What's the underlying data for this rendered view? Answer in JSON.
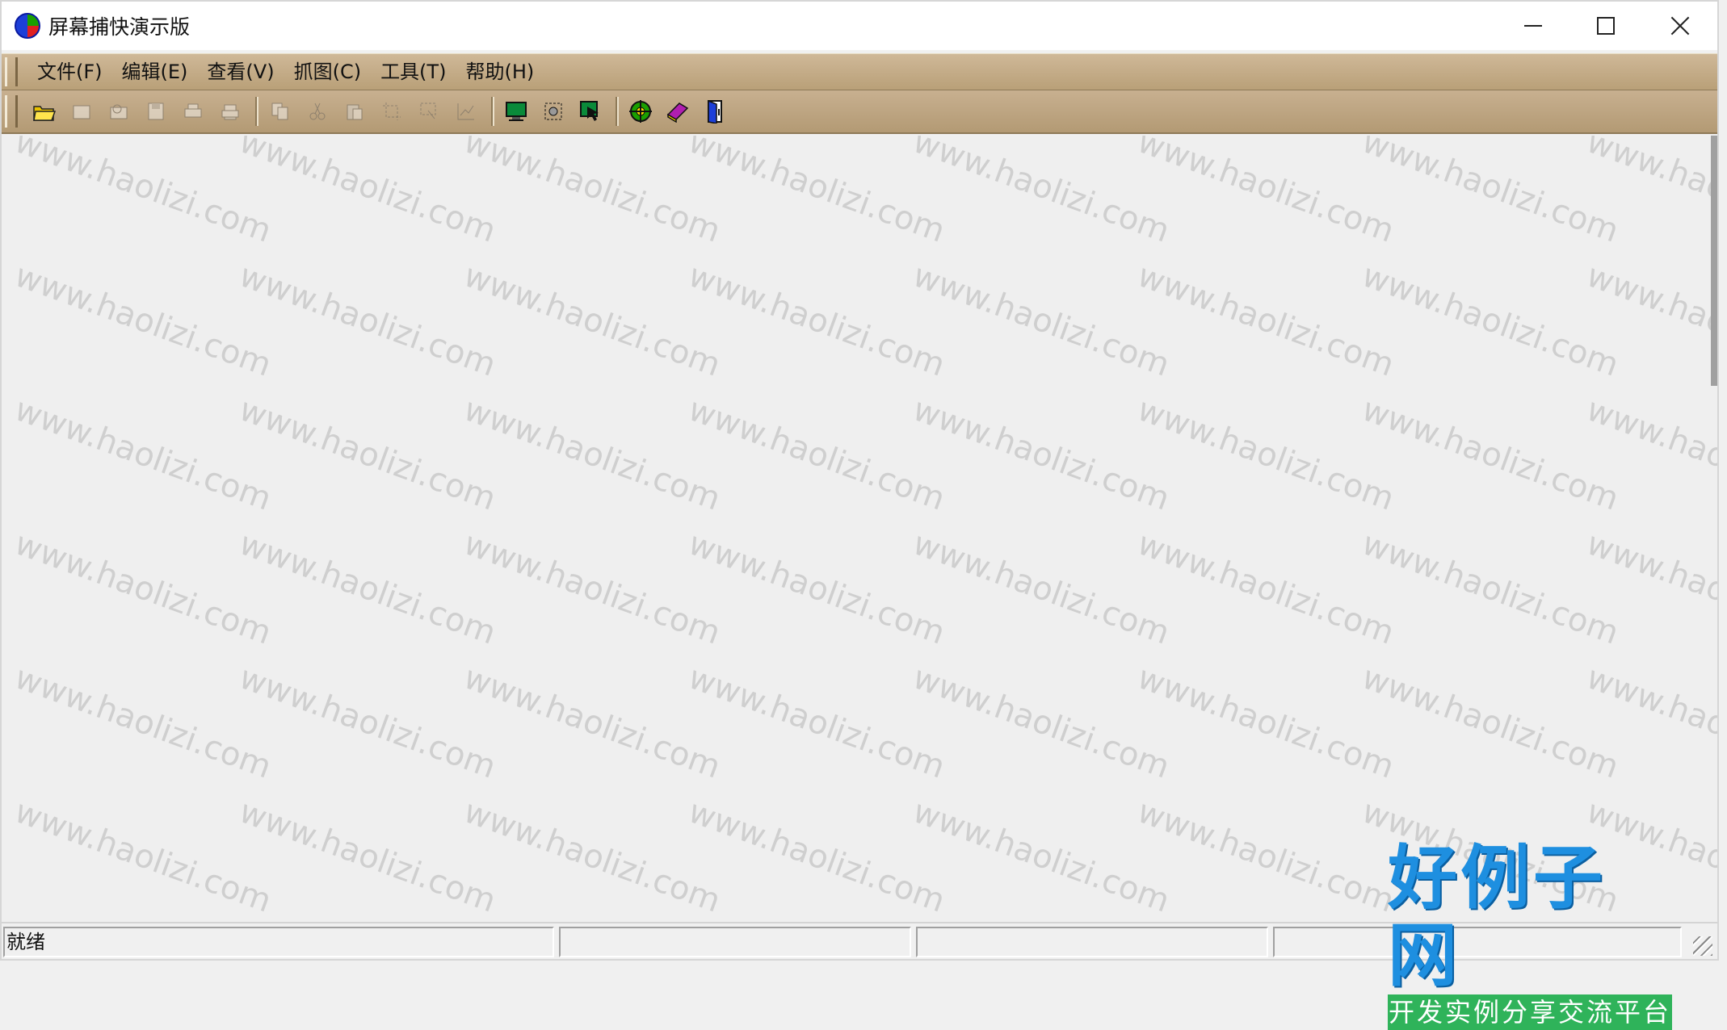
{
  "window": {
    "title": "屏幕捕快演示版"
  },
  "menu": [
    "文件(F)",
    "编辑(E)",
    "查看(V)",
    "抓图(C)",
    "工具(T)",
    "帮助(H)"
  ],
  "toolbar": {
    "groups": [
      [
        "open-folder-icon",
        "new-icon",
        "print-preview-icon",
        "save-icon",
        "print-setup-icon",
        "print-icon"
      ],
      [
        "copy-icon",
        "cut-icon",
        "paste-icon",
        "crop-icon",
        "select-region-icon",
        "chart-icon"
      ],
      [
        "monitor-icon",
        "capture-object-icon",
        "capture-arrow-icon"
      ],
      [
        "target-icon",
        "book-icon",
        "exit-door-icon"
      ]
    ]
  },
  "watermark": "www.haolizi.com",
  "status": {
    "pane1": "就绪",
    "pane2": "",
    "pane3": "",
    "pane4": ""
  },
  "brand": {
    "main": "好例子网",
    "sub": "开发实例分享交流平台"
  }
}
